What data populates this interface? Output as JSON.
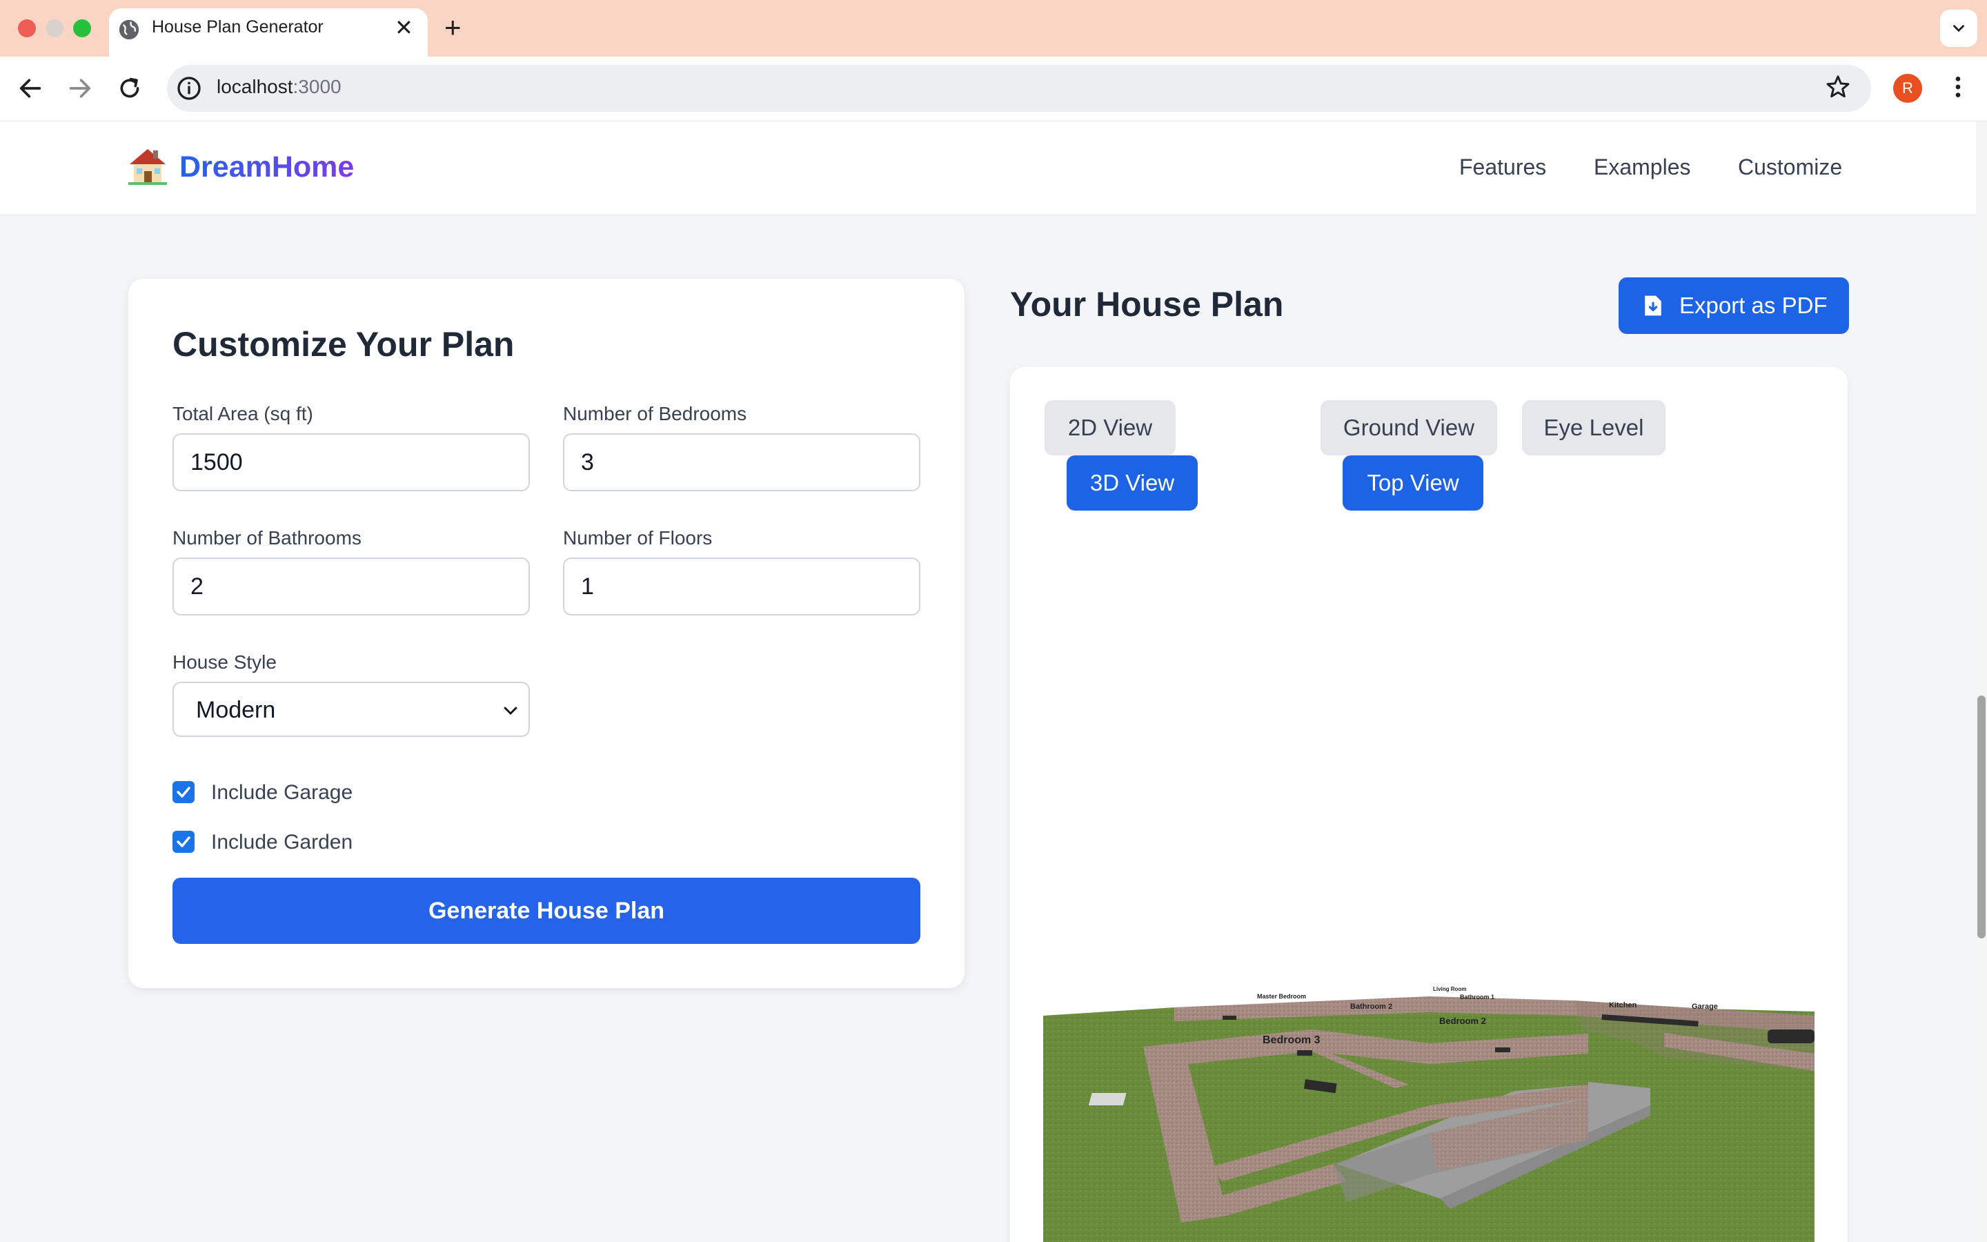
{
  "browser": {
    "tab_title": "House Plan Generator",
    "url_host": "localhost",
    "url_port": ":3000",
    "profile_initial": "R"
  },
  "site": {
    "logo_emoji": "house",
    "logo_text": "DreamHome",
    "nav": [
      "Features",
      "Examples",
      "Customize"
    ]
  },
  "form": {
    "title": "Customize Your Plan",
    "total_area_label": "Total Area (sq ft)",
    "total_area_value": "1500",
    "bedrooms_label": "Number of Bedrooms",
    "bedrooms_value": "3",
    "bathrooms_label": "Number of Bathrooms",
    "bathrooms_value": "2",
    "floors_label": "Number of Floors",
    "floors_value": "1",
    "style_label": "House Style",
    "style_value": "Modern",
    "garage_label": "Include Garage",
    "garage_checked": true,
    "garden_label": "Include Garden",
    "garden_checked": true,
    "generate_label": "Generate House Plan"
  },
  "plan": {
    "title": "Your House Plan",
    "export_label": "Export as PDF",
    "views": {
      "view_2d": "2D View",
      "view_3d": "3D View",
      "ground": "Ground View",
      "top": "Top View",
      "eye": "Eye Level"
    },
    "active_views": [
      "3D View",
      "Top View"
    ],
    "room_labels": {
      "master_bedroom": "Master Bedroom",
      "living_room": "Living Room",
      "bathroom_1": "Bathroom 1",
      "bathroom_2": "Bathroom 2",
      "bedroom_2": "Bedroom 2",
      "bedroom_3": "Bedroom 3",
      "kitchen": "Kitchen",
      "garage": "Garage"
    }
  },
  "colors": {
    "primary": "#2563eb",
    "grass": "#6b8c3c",
    "wall": "#a58b82",
    "garage_floor": "#9e9e9e",
    "tab_bar": "#fbd5c4"
  }
}
